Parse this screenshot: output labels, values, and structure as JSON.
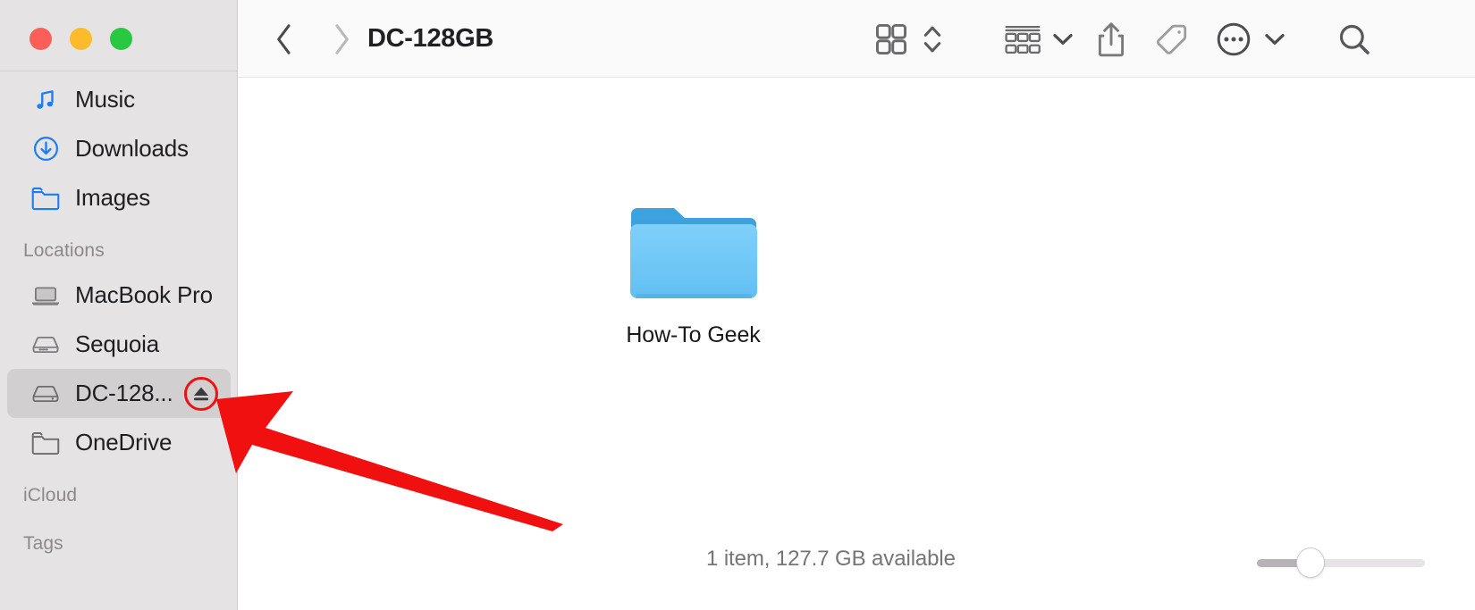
{
  "window": {
    "traffic_lights": [
      {
        "name": "close",
        "color": "#fb5f57"
      },
      {
        "name": "minimize",
        "color": "#fcbb2b"
      },
      {
        "name": "maximize",
        "color": "#28c840"
      }
    ]
  },
  "sidebar": {
    "rows": [
      {
        "type": "item",
        "label": "Music",
        "icon": "music-note-icon",
        "selected": false,
        "eject": false
      },
      {
        "type": "item",
        "label": "Downloads",
        "icon": "download-icon",
        "selected": false,
        "eject": false
      },
      {
        "type": "item",
        "label": "Images",
        "icon": "folder-icon",
        "selected": false,
        "eject": false
      },
      {
        "type": "header",
        "label": "Locations"
      },
      {
        "type": "item",
        "label": "MacBook Pro",
        "icon": "laptop-icon",
        "selected": false,
        "eject": false
      },
      {
        "type": "item",
        "label": "Sequoia",
        "icon": "hard-drive-icon",
        "selected": false,
        "eject": false
      },
      {
        "type": "item",
        "label": "DC-128...",
        "icon": "external-drive-icon",
        "selected": true,
        "eject": true
      },
      {
        "type": "item",
        "label": "OneDrive",
        "icon": "folder-icon",
        "selected": false,
        "eject": false
      },
      {
        "type": "header",
        "label": "iCloud"
      },
      {
        "type": "header",
        "label": "Tags"
      }
    ]
  },
  "toolbar": {
    "back_icon": "chevron-left-icon",
    "forward_icon": "chevron-right-icon",
    "title": "DC-128GB",
    "view_grid_icon": "grid-view-icon",
    "view_stepper_icon": "stepper-up-down-icon",
    "group_icon": "group-by-icon",
    "group_caret_icon": "chevron-down-icon",
    "share_icon": "share-icon",
    "tag_icon": "tag-icon",
    "more_icon": "ellipsis-circle-icon",
    "more_caret_icon": "chevron-down-icon",
    "search_icon": "search-icon"
  },
  "content": {
    "items": [
      {
        "label": "How-To Geek",
        "icon": "blue-folder-icon"
      }
    ]
  },
  "status": {
    "text": "1 item, 127.7 GB available",
    "zoom_slider_value": 30
  },
  "annotation": {
    "arrow_color": "#f01010",
    "arrow_points_to": "eject-button",
    "eject_highlight_color": "#ee1111"
  },
  "colors": {
    "sidebar_bg": "#e6e3e4",
    "toolbar_bg": "#fbfafb",
    "content_bg": "#ffffff",
    "selection_bg": "#d2cfd0",
    "accent_blue": "#1b7ef5",
    "folder_blue": "#6dc5f5"
  }
}
